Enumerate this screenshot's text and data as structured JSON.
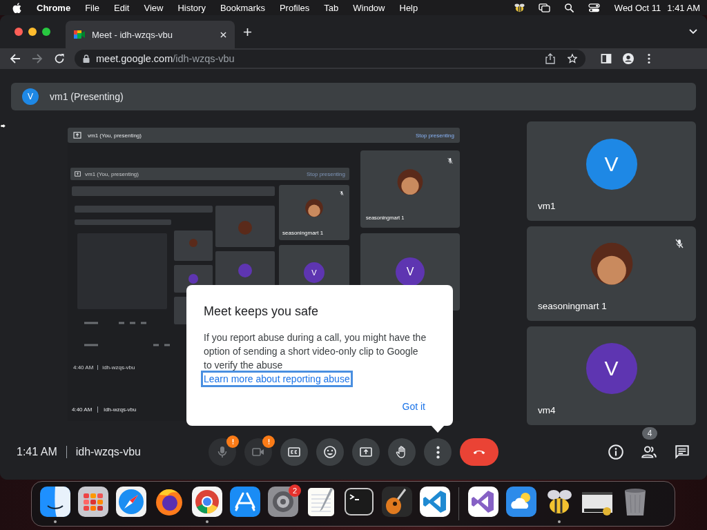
{
  "menu_bar": {
    "app": "Chrome",
    "items": [
      "File",
      "Edit",
      "View",
      "History",
      "Bookmarks",
      "Profiles",
      "Tab",
      "Window",
      "Help"
    ],
    "date": "Wed Oct 11",
    "time": "1:41 AM"
  },
  "browser": {
    "tab": {
      "title": "Meet - idh-wzqs-vbu",
      "selected": true
    },
    "forward_enabled": false,
    "url": {
      "host": "meet.google.com",
      "path": "/idh-wzqs-vbu"
    }
  },
  "meet": {
    "presenter_bar": {
      "initial": "V",
      "label": "vm1 (Presenting)"
    },
    "shared_screen": {
      "bar": {
        "label": "vm1 (You, presenting)",
        "action": "Stop presenting"
      },
      "tiles": [
        {
          "name": "seasoningmart 1",
          "kind": "avatar",
          "muted": true
        },
        {
          "kind": "letter",
          "letter": "V",
          "color": "#5e35b1",
          "muted": false
        }
      ],
      "footer": {
        "time": "4:40 AM",
        "meeting": "idh-wzqs-vbu"
      },
      "nested": {
        "bar": {
          "label": "vm1 (You, presenting)",
          "action": "Stop presenting"
        },
        "tiles": [
          {
            "name": "seasoningmart 1",
            "kind": "avatar",
            "muted": true
          },
          {
            "kind": "letter",
            "letter": "V",
            "color": "#5e35b1",
            "muted": false
          }
        ],
        "footer": {
          "time": "4:40 AM",
          "meeting": "idh-wzqs-vbu"
        }
      }
    },
    "tiles": [
      {
        "name": "vm1",
        "kind": "letter",
        "letter": "V",
        "color": "#1e88e5",
        "muted": false
      },
      {
        "name": "seasoningmart 1",
        "kind": "avatar",
        "muted": true
      },
      {
        "name": "vm4",
        "kind": "letter",
        "letter": "V",
        "color": "#5e35b1",
        "muted": false
      }
    ],
    "dialog": {
      "title": "Meet keeps you safe",
      "body": "If you report abuse during a call, you might have the option of sending a short video-only clip to Google to verify the abuse",
      "link": {
        "text": "Learn more about reporting abuse",
        "focused": true
      },
      "button": "Got it"
    },
    "toolbar": {
      "time": "1:41 AM",
      "meeting": "idh-wzqs-vbu",
      "controls": [
        {
          "kind": "mic",
          "warning": true,
          "disabled": true
        },
        {
          "kind": "camera",
          "warning": true,
          "disabled": true
        },
        {
          "kind": "captions",
          "warning": false,
          "disabled": false
        },
        {
          "kind": "emoji",
          "warning": false,
          "disabled": false
        },
        {
          "kind": "present",
          "warning": false,
          "disabled": false
        },
        {
          "kind": "hand",
          "warning": false,
          "disabled": false
        },
        {
          "kind": "more",
          "warning": false,
          "disabled": false
        },
        {
          "kind": "hangup",
          "warning": false,
          "disabled": false
        }
      ],
      "side_buttons": [
        {
          "kind": "info"
        },
        {
          "kind": "people",
          "badge": "4"
        },
        {
          "kind": "chat"
        }
      ]
    }
  },
  "dock": [
    {
      "kind": "finder",
      "running": true
    },
    {
      "kind": "launchpad",
      "running": false
    },
    {
      "kind": "safari",
      "running": false
    },
    {
      "kind": "firefox",
      "running": false
    },
    {
      "kind": "chrome",
      "running": true
    },
    {
      "kind": "appstore",
      "running": false
    },
    {
      "kind": "settings",
      "running": false,
      "badge": "2"
    },
    {
      "kind": "textedit",
      "running": false
    },
    {
      "kind": "terminal",
      "running": false
    },
    {
      "kind": "guitar",
      "running": false
    },
    {
      "kind": "vscode",
      "running": false
    },
    {
      "kind": "divider"
    },
    {
      "kind": "visualstudio",
      "running": false
    },
    {
      "kind": "weather",
      "running": false
    },
    {
      "kind": "bee",
      "running": true
    },
    {
      "kind": "window",
      "running": false
    },
    {
      "kind": "trash",
      "running": false
    }
  ]
}
